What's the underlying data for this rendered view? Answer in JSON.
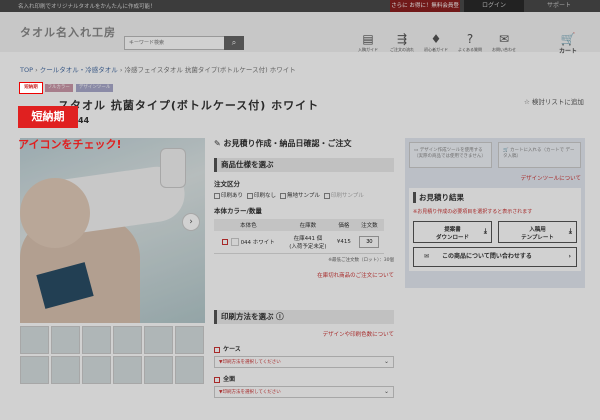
{
  "topbar": {
    "message": "名入れ印刷でオリジナルタオルをかんたんに作成可能！",
    "register": "さらに お得に！無料会員登録",
    "login": "ログイン",
    "support": "サポート"
  },
  "header": {
    "logo": "タオル名入れ工房",
    "search_placeholder": "キーワード検索",
    "icons": [
      {
        "label": "入稿ガイド",
        "icon": "document-icon"
      },
      {
        "label": "ご注文の流れ",
        "icon": "flow-icon"
      },
      {
        "label": "初心者ガイド",
        "icon": "leaf-icon"
      },
      {
        "label": "よくある質問",
        "icon": "question-icon"
      },
      {
        "label": "お問い合わせ",
        "icon": "mail-icon"
      }
    ],
    "cart_label": "カート"
  },
  "breadcrumb": {
    "items": [
      "TOP",
      "クールタオル・冷感タオル",
      "冷感フェイスタオル 抗菌タイプ(ボトルケース付) ホワイト"
    ]
  },
  "badges": [
    "短納期",
    "フルカラー",
    "デザインツール"
  ],
  "product": {
    "title": "スタオル 抗菌タイプ(ボトルケース付) ホワイト",
    "code": "04-044",
    "wishlist": "検討リストに追加"
  },
  "callout": {
    "tag": "短納期",
    "text": "アイコンをチェック!"
  },
  "order": {
    "section_title": "お見積り作成・納品日確認・ご注文",
    "spec_title": "商品仕様を選ぶ",
    "order_type_label": "注文区分",
    "order_types": [
      "印刷あり",
      "印刷なし",
      "無地サンプル",
      "印刷サンプル"
    ],
    "body_color_label": "本体カラー/数量",
    "table_headers": [
      "本体色",
      "在庫数",
      "価格",
      "注文数"
    ],
    "row": {
      "color": "044 ホワイト",
      "stock": "在庫441 個\n(入荷予定未定)",
      "price": "¥415",
      "qty": "30"
    },
    "min_order": "※最低ご注文数（ロット）：30個",
    "out_of_stock_link": "在庫切れ商品のご注文について",
    "print_title": "印刷方法を選ぶ",
    "design_link": "デザインや印刷色数について",
    "print_options": [
      {
        "label": "ケース",
        "placeholder": "▼印刷方法を選択してください"
      },
      {
        "label": "全面",
        "placeholder": "▼印刷方法を選択してください"
      }
    ]
  },
  "sidebar": {
    "design_tool_btn": "デザイン作成ツールを使用する（実際の商品では使用できません）",
    "cart_btn": "カートに入れる（カートで データ入稿）",
    "tool_link": "デザインツールについて",
    "estimate_title": "お見積り結果",
    "warning": "※お見積り作成の必要項目を選択すると表示されます",
    "download_btn": "提案書\nダウンロード",
    "template_btn": "入稿用\nテンプレート",
    "ask_btn": "この商品について問い合わせする"
  }
}
